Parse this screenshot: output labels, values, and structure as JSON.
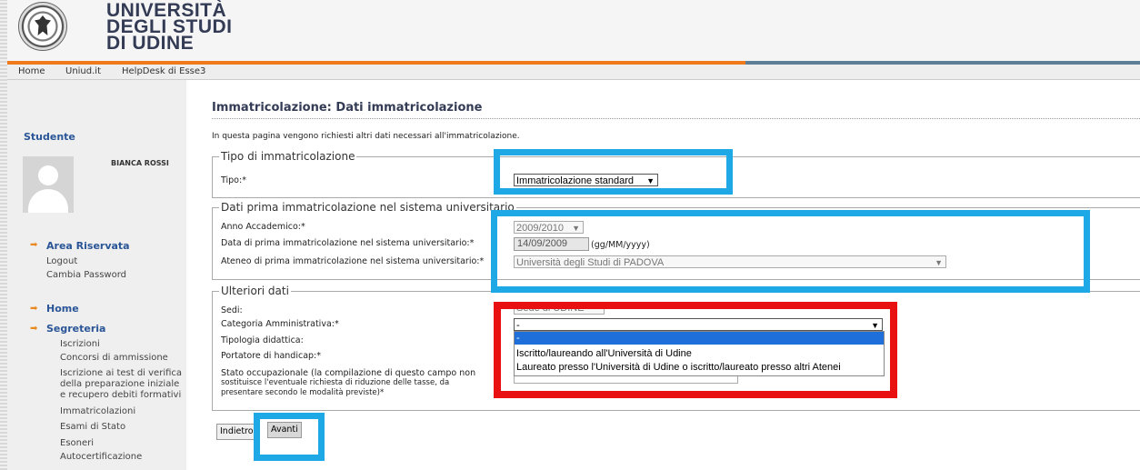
{
  "header": {
    "logo_line1": "UNIVERSITÀ",
    "logo_line2": "DEGLI STUDI",
    "logo_line3": "DI UDINE"
  },
  "nav": {
    "items": [
      "Home",
      "Uniud.it",
      "HelpDesk di Esse3"
    ]
  },
  "sidebar": {
    "title": "Studente",
    "user_name": "BIANCA ROSSI",
    "area_riservata": "Area Riservata",
    "logout": "Logout",
    "cambia_password": "Cambia Password",
    "home": "Home",
    "segreteria": "Segreteria",
    "items": [
      "Iscrizioni",
      "Concorsi di ammissione",
      "Iscrizione ai test di verifica",
      "della preparazione iniziale",
      "e recupero debiti formativi",
      "Immatricolazioni",
      "Esami di Stato",
      "Esoneri",
      "Autocertificazione"
    ]
  },
  "main": {
    "title": "Immatricolazione: Dati immatricolazione",
    "intro": "In questa pagina vengono richiesti altri dati necessari all'immatricolazione.",
    "section1": {
      "legend": "Tipo di immatricolazione",
      "tipo_label": "Tipo:*",
      "tipo_value": "Immatricolazione standard"
    },
    "section2": {
      "legend": "Dati prima immatricolazione nel sistema universitario",
      "anno_label": "Anno Accademico:*",
      "anno_value": "2009/2010",
      "data_label": "Data di prima immatricolazione nel sistema universitario:*",
      "data_value": "14/09/2009",
      "data_format": "(gg/MM/yyyy)",
      "ateneo_label": "Ateneo di prima immatricolazione nel sistema universitario:*",
      "ateneo_value": "Università degli Studi di PADOVA"
    },
    "section3": {
      "legend": "Ulteriori dati",
      "sedi_label": "Sedi:",
      "sedi_value": "Sede di UDINE",
      "categoria_label": "Categoria Amministrativa:*",
      "categoria_value": "-",
      "tipologia_label": "Tipologia didattica:",
      "handicap_label": "Portatore di handicap:*",
      "stato_label_1": "Stato occupazionale (la compilazione di questo campo non",
      "stato_label_2": "sostituisce l'eventuale richiesta di riduzione delle tasse, da",
      "stato_label_3": "presentare secondo le modalità previste)*"
    },
    "dropdown_options": [
      "-",
      "Iscritto/laureando all'Università di Udine",
      "Laureato presso l'Università di Udine o iscritto/laureato presso altri Atenei"
    ],
    "buttons": {
      "back": "Indietro",
      "next": "Avanti"
    }
  },
  "colors": {
    "highlight_blue": "#1ea8e6",
    "highlight_red": "#e81010",
    "brand_orange": "#f07a1a",
    "title_blue": "#2a5597"
  }
}
